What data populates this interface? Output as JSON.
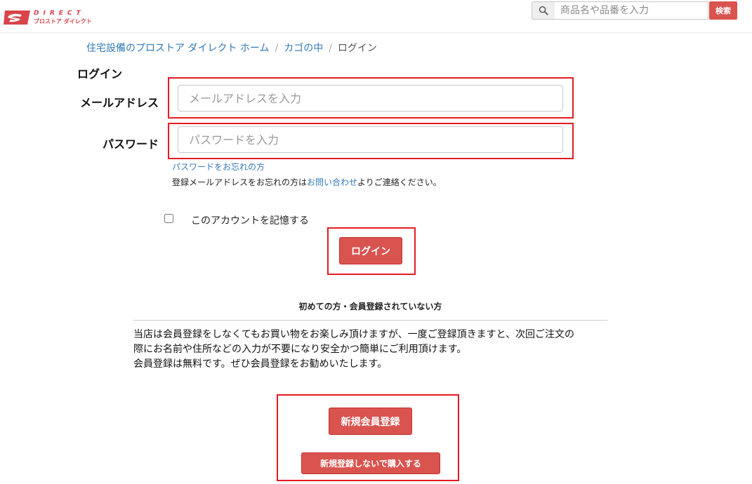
{
  "header": {
    "logo": {
      "brand_top": "DIRECT",
      "brand_bottom": "プロストア ダイレクト"
    },
    "search": {
      "placeholder": "商品名や品番を入力",
      "button_label": "検索"
    }
  },
  "breadcrumb": {
    "items": [
      "住宅設備のプロストア ダイレクト ホーム",
      "カゴの中"
    ],
    "current": "ログイン"
  },
  "login": {
    "title": "ログイン",
    "email_label": "メールアドレス",
    "email_placeholder": "メールアドレスを入力",
    "email_value": "",
    "password_label": "パスワード",
    "password_placeholder": "パスワードを入力",
    "password_value": "",
    "forgot_password_link": "パスワードをお忘れの方",
    "forgot_email_prefix": "登録メールアドレスをお忘れの方は",
    "forgot_email_link": "お問い合わせ",
    "forgot_email_suffix": "よりご連絡ください。",
    "remember_label": "このアカウントを記憶する",
    "remember_checked": false,
    "submit_label": "ログイン"
  },
  "register": {
    "title": "初めての方・会員登録されていない方",
    "description_line1": "当店は会員登録をしなくてもお買い物をお楽しみ頂けますが、一度ご登録頂きますと、次回ご注文の",
    "description_line2": "際にお名前や住所などの入力が不要になり安全かつ簡単にご利用頂けます。",
    "description_line3": "会員登録は無料です。ぜひ会員登録をお勧めいたします。",
    "register_button": "新規会員登録",
    "guest_button": "新規登録しないで購入する"
  },
  "colors": {
    "accent_red": "#d9534f",
    "highlight_border": "#e41b23",
    "link_blue": "#337ab7"
  },
  "icons": {
    "logo": "direct-logo-icon",
    "search": "magnifier-icon"
  }
}
